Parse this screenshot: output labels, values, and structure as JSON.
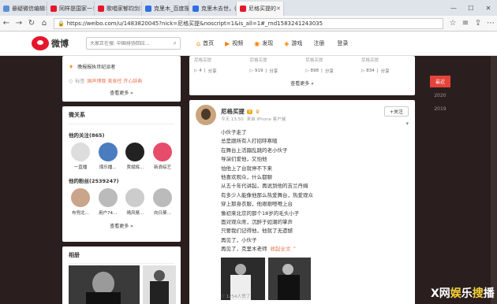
{
  "browser": {
    "tabs": [
      {
        "label": "悬疑微信编辑",
        "color": "#5b8fd8"
      },
      {
        "label": "同样是国家一",
        "color": "#e6162d"
      },
      {
        "label": "歌唱家郁钧剑",
        "color": "#e6162d"
      },
      {
        "label": "克里木_百度搜",
        "color": "#2f6fe4"
      },
      {
        "label": "克里木去世，(",
        "color": "#2f6fe4"
      },
      {
        "label": "尼格买提的",
        "color": "#e6162d",
        "active": true
      }
    ],
    "url": "https://weibo.com/u/1483820045?nick=尼格买提&noscript=1&is_all=1#_rnd1583241243035"
  },
  "topnav": {
    "logo_text": "微博",
    "search_placeholder": "大家正在搜: 中国排协回应...",
    "items": [
      {
        "label": "首页",
        "icon": "home-icon",
        "glyph": "⌂"
      },
      {
        "label": "视频",
        "icon": "video-icon",
        "glyph": "▶"
      },
      {
        "label": "发现",
        "icon": "discover-icon",
        "glyph": "◉"
      },
      {
        "label": "游戏",
        "icon": "game-icon",
        "glyph": "◈"
      }
    ],
    "register": "注册",
    "login": "登录"
  },
  "profile": {
    "info_line": "晚报报执世纪派者",
    "tags_label": "标签",
    "tags_value": "国声博观 美食控 开心辞典",
    "view_more": "查看更多 »"
  },
  "relations": {
    "title": "微关系",
    "follows_label": "他的关注(865)",
    "follows": [
      {
        "name": "一直播",
        "color": "#ddd"
      },
      {
        "name": "煤乐播...",
        "color": "#4a7dbf"
      },
      {
        "name": "贾斌辉...",
        "color": "#222"
      },
      {
        "name": "新浪综艺",
        "color": "#e84c6c"
      }
    ],
    "fans_label": "他的粉丝(2539247)",
    "fans": [
      {
        "name": "布兜北...",
        "color": "#c9a58b"
      },
      {
        "name": "用户74...",
        "color": "#bbb"
      },
      {
        "name": "晴风晃...",
        "color": "#ccc"
      },
      {
        "name": "向日葵...",
        "color": "#bbb"
      }
    ],
    "view_more": "查看更多 »"
  },
  "photos": {
    "title": "相册"
  },
  "top_videos": [
    {
      "author": "尼格买提",
      "count": "4",
      "share": "分享"
    },
    {
      "author": "尼格买提",
      "count": "919",
      "share": "分享"
    },
    {
      "author": "尼格买提",
      "count": "898",
      "share": "分享"
    },
    {
      "author": "尼格买提",
      "count": "834",
      "share": "分享"
    }
  ],
  "top_view_more": "查看更多 »",
  "post": {
    "author": "尼格买提",
    "badge": "V",
    "time": "今天 13:50",
    "source": "来自 iPhone 客户端",
    "follow": "+关注",
    "lines": [
      "小伙子走了",
      "总是跟所有人打招呼寒暄",
      "在舞台上活蹦乱跳的老小伙子",
      "导演们爱他，又怕他",
      "怕他上了台就停不下来",
      "他喜欢观众，什么都聊",
      "从五十年代讲起，再说到他的吉兰丹姆",
      "有多少人能像他那么热爱舞台，热爱观众",
      "穿上那身衣服，他艰艰噔噔上台",
      "像初来北京的那个18岁的毛头小子",
      "面对观众席，沉醉于如潮的掌声",
      "只要我们记得他，他就了无遗憾",
      "再见了，小伙子",
      "再见了，克里木老师"
    ],
    "collapse": "收起全文",
    "liked": "1254人赞了"
  },
  "year_sidebar": [
    {
      "label": "最近",
      "active": true
    },
    {
      "label": "2020",
      "active": false
    },
    {
      "label": "2019",
      "active": false
    }
  ],
  "watermark": {
    "part1": "X网",
    "part2": "娱",
    "part3": "乐",
    "part4": "搜",
    "part5": "播"
  }
}
